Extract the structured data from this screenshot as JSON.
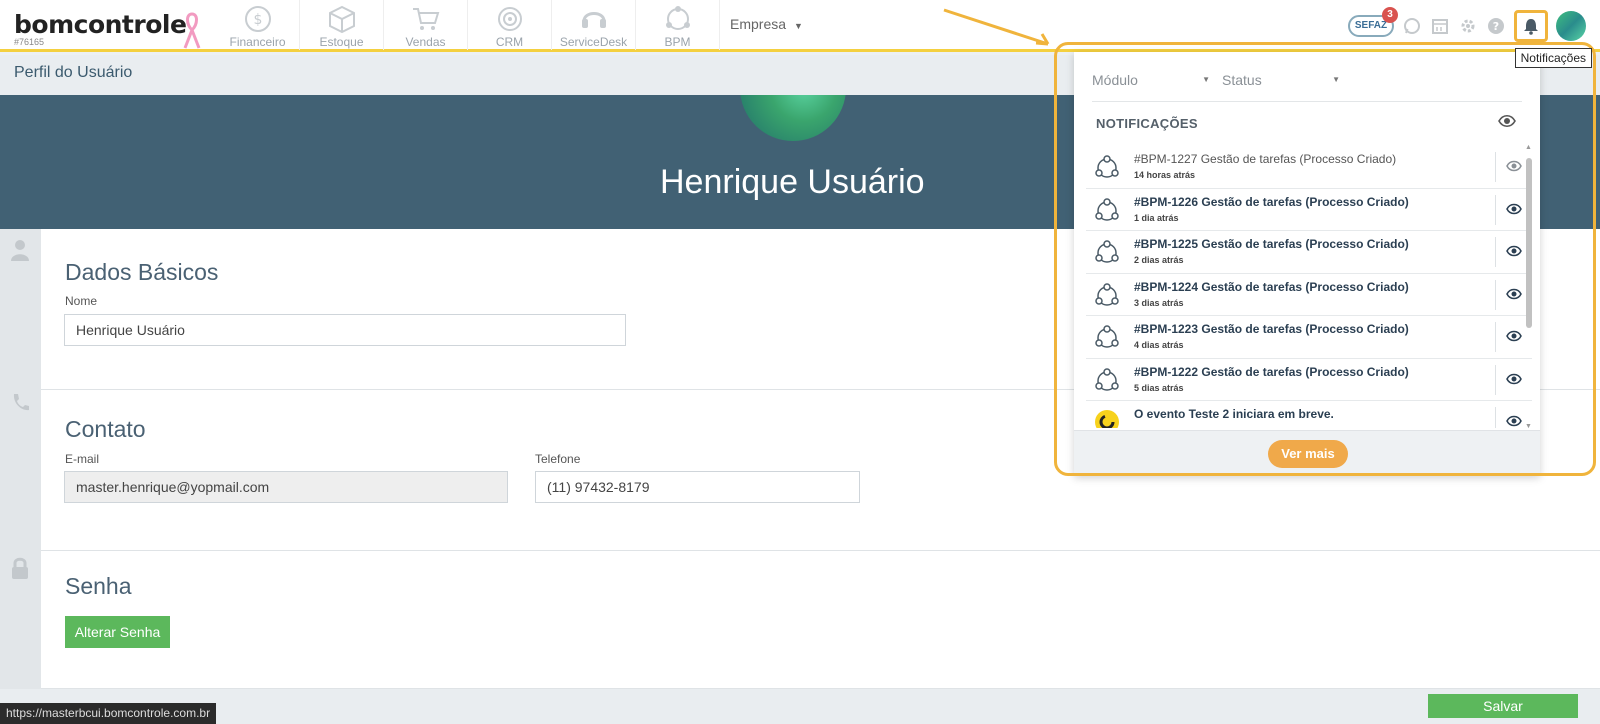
{
  "brand": {
    "name": "bomcontrole",
    "account_id": "#76165"
  },
  "modules": [
    {
      "label": "Financeiro",
      "icon": "dollar-icon"
    },
    {
      "label": "Estoque",
      "icon": "box-icon"
    },
    {
      "label": "Vendas",
      "icon": "cart-icon"
    },
    {
      "label": "CRM",
      "icon": "target-icon"
    },
    {
      "label": "ServiceDesk",
      "icon": "headset-icon"
    },
    {
      "label": "BPM",
      "icon": "network-icon"
    }
  ],
  "company_menu": {
    "label": "Empresa"
  },
  "header_icons": {
    "sefaz_label": "SEFAZ",
    "sefaz_count": "3"
  },
  "tooltip": "Notificações",
  "page": {
    "title": "Perfil do Usuário"
  },
  "profile": {
    "name": "Henrique Usuário"
  },
  "basic": {
    "title": "Dados Básicos",
    "name_label": "Nome",
    "name_value": "Henrique Usuário"
  },
  "contact": {
    "title": "Contato",
    "email_label": "E-mail",
    "email_value": "master.henrique@yopmail.com",
    "phone_label": "Telefone",
    "phone_value": "(11) 97432-8179"
  },
  "password": {
    "title": "Senha",
    "change_button": "Alterar Senha"
  },
  "footer": {
    "save_button": "Salvar",
    "status_url": "https://masterbcui.bomcontrole.com.br"
  },
  "notifications": {
    "filters": {
      "module": "Módulo",
      "status": "Status"
    },
    "header": "NOTIFICAÇÕES",
    "items": [
      {
        "title": "#BPM-1227 Gestão de tarefas (Processo Criado)",
        "time": "14 horas atrás",
        "read": true
      },
      {
        "title": "#BPM-1226 Gestão de tarefas (Processo Criado)",
        "time": "1 dia atrás",
        "read": false
      },
      {
        "title": "#BPM-1225 Gestão de tarefas (Processo Criado)",
        "time": "2 dias atrás",
        "read": false
      },
      {
        "title": "#BPM-1224 Gestão de tarefas (Processo Criado)",
        "time": "3 dias atrás",
        "read": false
      },
      {
        "title": "#BPM-1223 Gestão de tarefas (Processo Criado)",
        "time": "4 dias atrás",
        "read": false
      },
      {
        "title": "#BPM-1222 Gestão de tarefas (Processo Criado)",
        "time": "5 dias atrás",
        "read": false
      },
      {
        "title": "O evento Teste 2 iniciara em breve.",
        "time": "",
        "read": false
      }
    ],
    "see_more": "Ver mais"
  },
  "colors": {
    "accent": "#f0b43c",
    "banner": "#416174",
    "success": "#5cb85c",
    "see_more": "#f0a94a"
  }
}
